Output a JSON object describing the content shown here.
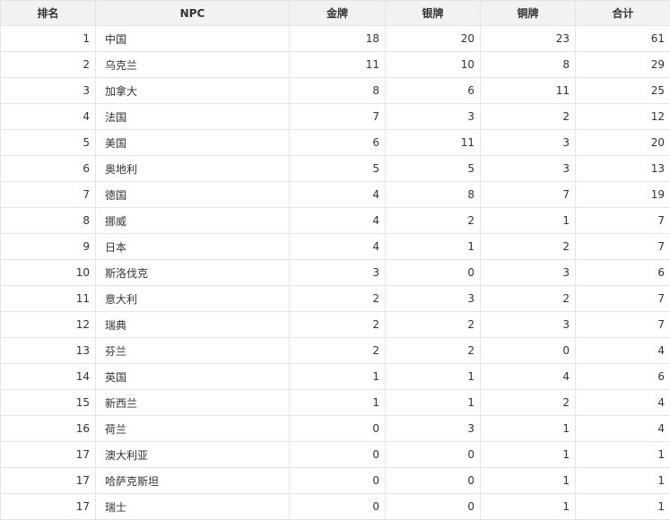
{
  "table": {
    "headers": {
      "rank": "排名",
      "npc": "NPC",
      "gold": "金牌",
      "silver": "银牌",
      "bronze": "铜牌",
      "total": "合计"
    },
    "rows": [
      {
        "rank": "1",
        "npc": "中国",
        "gold": "18",
        "silver": "20",
        "bronze": "23",
        "total": "61"
      },
      {
        "rank": "2",
        "npc": "乌克兰",
        "gold": "11",
        "silver": "10",
        "bronze": "8",
        "total": "29"
      },
      {
        "rank": "3",
        "npc": "加拿大",
        "gold": "8",
        "silver": "6",
        "bronze": "11",
        "total": "25"
      },
      {
        "rank": "4",
        "npc": "法国",
        "gold": "7",
        "silver": "3",
        "bronze": "2",
        "total": "12"
      },
      {
        "rank": "5",
        "npc": "美国",
        "gold": "6",
        "silver": "11",
        "bronze": "3",
        "total": "20"
      },
      {
        "rank": "6",
        "npc": "奥地利",
        "gold": "5",
        "silver": "5",
        "bronze": "3",
        "total": "13"
      },
      {
        "rank": "7",
        "npc": "德国",
        "gold": "4",
        "silver": "8",
        "bronze": "7",
        "total": "19"
      },
      {
        "rank": "8",
        "npc": "挪威",
        "gold": "4",
        "silver": "2",
        "bronze": "1",
        "total": "7"
      },
      {
        "rank": "9",
        "npc": "日本",
        "gold": "4",
        "silver": "1",
        "bronze": "2",
        "total": "7"
      },
      {
        "rank": "10",
        "npc": "斯洛伐克",
        "gold": "3",
        "silver": "0",
        "bronze": "3",
        "total": "6"
      },
      {
        "rank": "11",
        "npc": "意大利",
        "gold": "2",
        "silver": "3",
        "bronze": "2",
        "total": "7"
      },
      {
        "rank": "12",
        "npc": "瑞典",
        "gold": "2",
        "silver": "2",
        "bronze": "3",
        "total": "7"
      },
      {
        "rank": "13",
        "npc": "芬兰",
        "gold": "2",
        "silver": "2",
        "bronze": "0",
        "total": "4"
      },
      {
        "rank": "14",
        "npc": "英国",
        "gold": "1",
        "silver": "1",
        "bronze": "4",
        "total": "6"
      },
      {
        "rank": "15",
        "npc": "新西兰",
        "gold": "1",
        "silver": "1",
        "bronze": "2",
        "total": "4"
      },
      {
        "rank": "16",
        "npc": "荷兰",
        "gold": "0",
        "silver": "3",
        "bronze": "1",
        "total": "4"
      },
      {
        "rank": "17",
        "npc": "澳大利亚",
        "gold": "0",
        "silver": "0",
        "bronze": "1",
        "total": "1"
      },
      {
        "rank": "17",
        "npc": "哈萨克斯坦",
        "gold": "0",
        "silver": "0",
        "bronze": "1",
        "total": "1"
      },
      {
        "rank": "17",
        "npc": "瑞士",
        "gold": "0",
        "silver": "0",
        "bronze": "1",
        "total": "1"
      }
    ]
  }
}
